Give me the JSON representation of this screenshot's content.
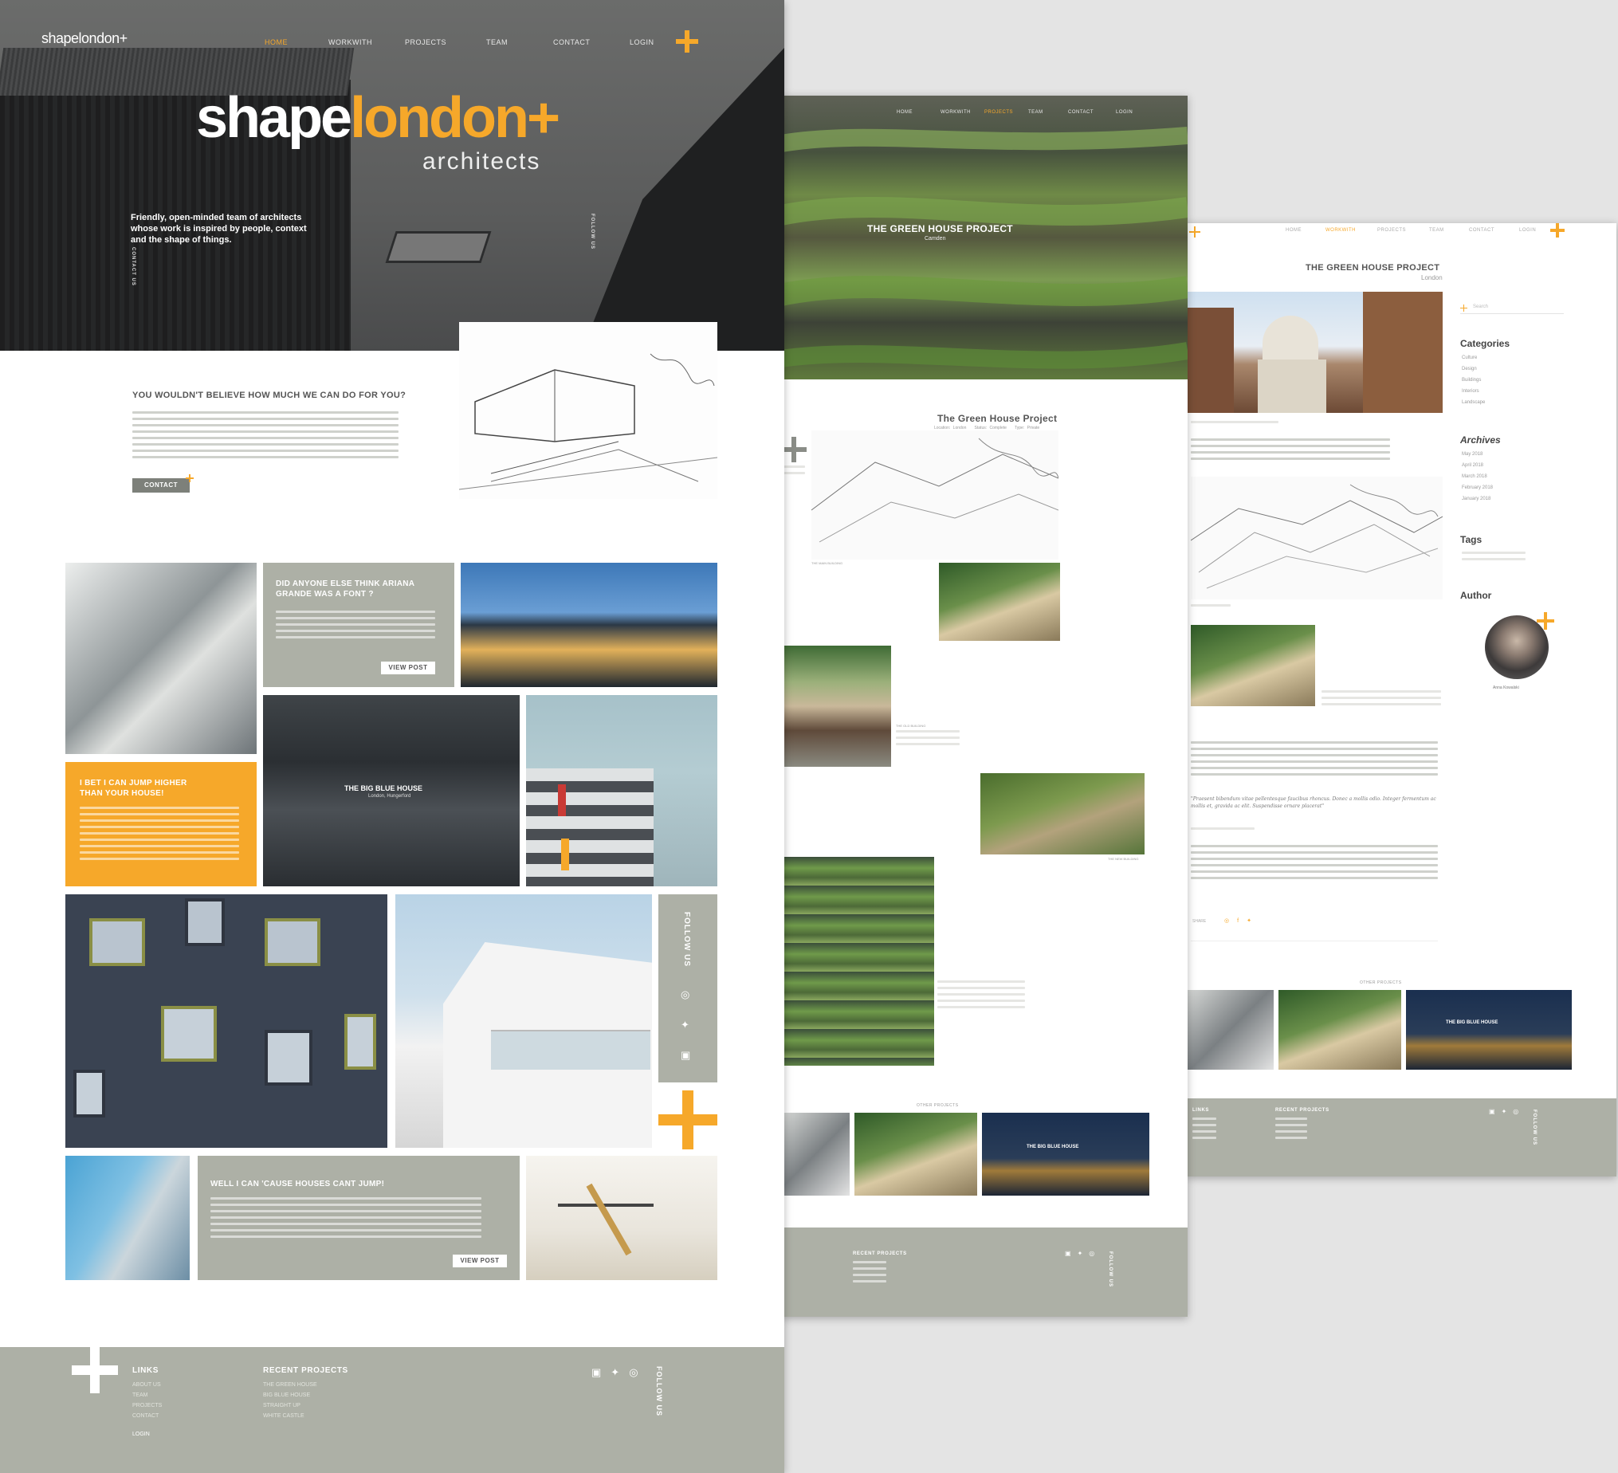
{
  "brand": {
    "logo": "shapelondon+",
    "hero_shape": "shape",
    "hero_london": "london+",
    "hero_sub": "architects"
  },
  "home": {
    "nav": [
      "HOME",
      "WORKWITH",
      "PROJECTS",
      "TEAM",
      "CONTACT",
      "LOGIN"
    ],
    "tagline_1": "Friendly, open-minded team of architects",
    "tagline_2": "whose work is inspired by people, context",
    "tagline_3": "and the shape of things.",
    "contact_vertical": "CONTACT US",
    "side_vertical": "FOLLOW US",
    "intro_title": "YOU WOULDN'T BELIEVE HOW MUCH WE CAN DO FOR YOU?",
    "contact_btn": "CONTACT",
    "card1_title_1": "DID ANYONE ELSE THINK ARIANA",
    "card1_title_2": "GRANDE WAS A FONT ?",
    "view_post": "VIEW POST",
    "card2_title_1": "I BET I CAN JUMP HIGHER",
    "card2_title_2": "THAN YOUR HOUSE!",
    "blue_house": "THE BIG BLUE HOUSE",
    "blue_house_sub": "London, Hungerford",
    "follow_us": "FOLLOW US",
    "card3_title": "WELL I CAN 'CAUSE HOUSES CANT JUMP!",
    "footer": {
      "links_h": "LINKS",
      "links": [
        "ABOUT US",
        "TEAM",
        "PROJECTS",
        "CONTACT"
      ],
      "login": "LOGIN",
      "recent_h": "RECENT PROJECTS",
      "recent": [
        "THE GREEN HOUSE",
        "BIG BLUE HOUSE",
        "STRAIGHT UP",
        "WHITE CASTLE"
      ],
      "follow": "FOLLOW US"
    }
  },
  "project": {
    "hero_title": "THE GREEN HOUSE PROJECT",
    "hero_sub": "Camden",
    "title": "The Green House Project",
    "meta": [
      "Location: London",
      "Status: Complete",
      "Type: Private"
    ],
    "cap1": "THE MAIN BUILDING",
    "cap2": "THE OLD BUILDING",
    "cap3": "THE NEW BUILDING",
    "cap4": "THE OLD BUILDING",
    "other": "OTHER PROJECTS",
    "overlay": "THE BIG BLUE HOUSE",
    "footer": {
      "recent_h": "RECENT PROJECTS",
      "follow": "FOLLOW US"
    }
  },
  "blog": {
    "title": "THE GREEN HOUSE PROJECT",
    "sub": "London",
    "search": "Search",
    "categories_h": "Categories",
    "categories": [
      "Culture",
      "Design",
      "Buildings",
      "Interiors",
      "Landscape"
    ],
    "archives_h": "Archives",
    "archives": [
      "May 2018",
      "April 2018",
      "March 2018",
      "February 2018",
      "January 2018"
    ],
    "tags_h": "Tags",
    "author_h": "Author",
    "author_name": "Anna Kowalski",
    "quote": "\"Praesent bibendum vitae pellentesque faucibus rhoncus. Donec a mollis odio. Integer fermentum ac mollis et, gravida ac elit. Suspendisse ornare placerat\"",
    "share": "SHARE",
    "other": "OTHER PROJECTS",
    "overlay": "THE BIG BLUE HOUSE",
    "footer": {
      "links_h": "LINKS",
      "recent_h": "RECENT PROJECTS",
      "follow": "FOLLOW US"
    }
  },
  "colors": {
    "accent": "#f6a82a",
    "sage": "#adb0a6",
    "dark": "#3b3d3f"
  }
}
